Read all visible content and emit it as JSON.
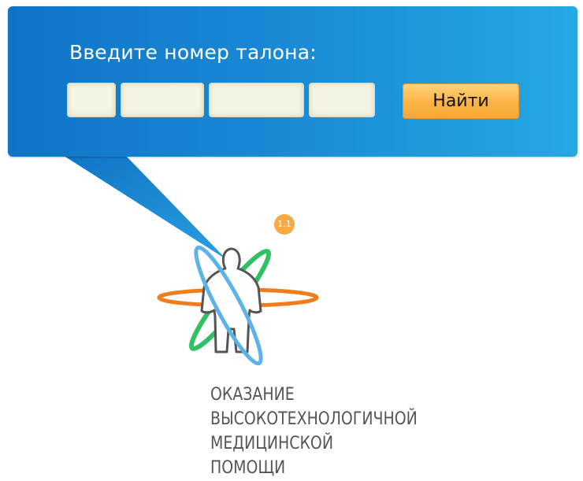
{
  "ticket_search": {
    "prompt": "Введите номер талона:",
    "fields": [
      "",
      "",
      "",
      ""
    ],
    "find_label": "Найти"
  },
  "logo": {
    "badge": "1.1",
    "caption_lines": [
      "ОКАЗАНИЕ",
      "ВЫСОКОТЕХНОЛОГИЧНОЙ",
      "МЕДИЦИНСКОЙ",
      "ПОМОЩИ"
    ],
    "colors": {
      "orange_orbit": "#f07d1b",
      "green_orbit": "#31c062",
      "blue_orbit": "#5db3e8",
      "figure": "#555555",
      "badge": "#f7a944"
    }
  },
  "theme": {
    "panel_gradient_start": "#0f74c5",
    "panel_gradient_end": "#25a8e3",
    "field_background": "#f4f4e4",
    "button_color": "#fbb345"
  }
}
